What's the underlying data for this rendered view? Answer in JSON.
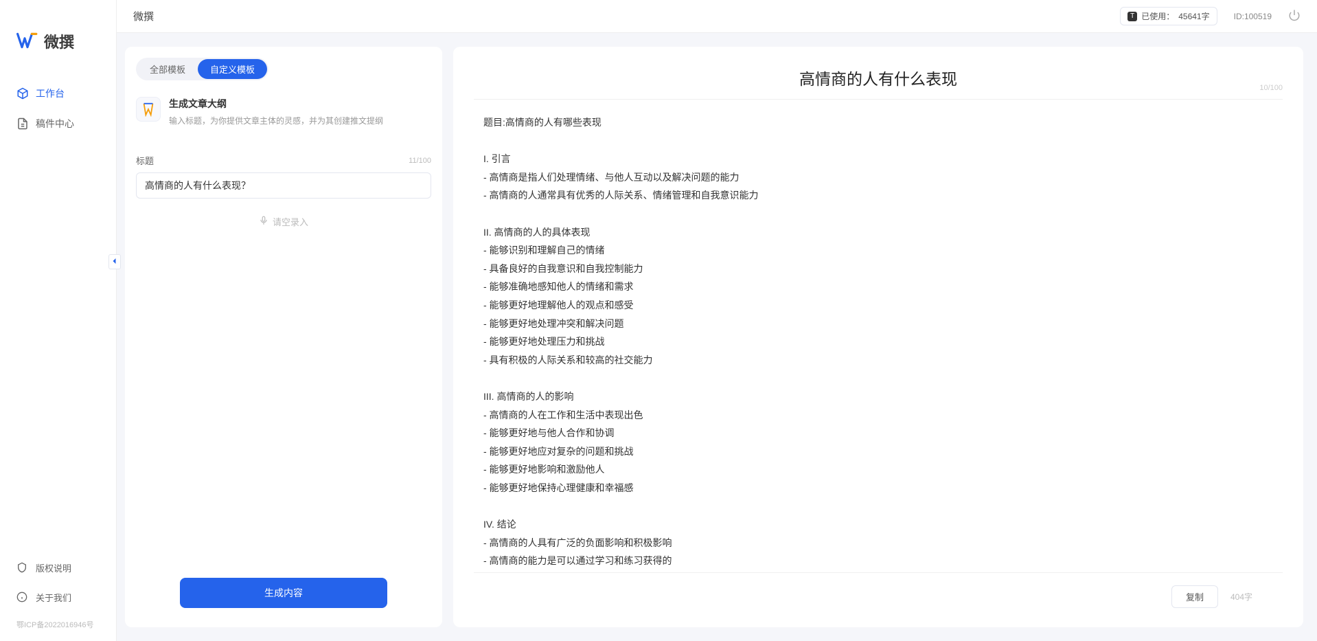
{
  "topbar": {
    "title": "微撰",
    "usage_prefix": "已使用：",
    "usage_value": "45641字",
    "user_id": "ID:100519"
  },
  "sidebar": {
    "logo_text": "微撰",
    "nav": [
      {
        "label": "工作台",
        "icon": "cube"
      },
      {
        "label": "稿件中心",
        "icon": "doc"
      }
    ],
    "footer": [
      {
        "label": "版权说明",
        "icon": "shield"
      },
      {
        "label": "关于我们",
        "icon": "info"
      }
    ],
    "icp": "鄂ICP备2022016946号"
  },
  "left_panel": {
    "tabs": [
      "全部模板",
      "自定义模板"
    ],
    "template": {
      "title": "生成文章大纲",
      "desc": "输入标题，为你提供文章主体的灵感，并为其创建推文提纲"
    },
    "title_label": "标题",
    "title_count": "11/100",
    "title_value": "高情商的人有什么表现？",
    "voice_hint": "请空录入",
    "generate_btn": "生成内容"
  },
  "right_panel": {
    "heading": "高情商的人有什么表现",
    "heading_count": "10/100",
    "body": "题目:高情商的人有哪些表现\n\nI. 引言\n- 高情商是指人们处理情绪、与他人互动以及解决问题的能力\n- 高情商的人通常具有优秀的人际关系、情绪管理和自我意识能力\n\nII. 高情商的人的具体表现\n- 能够识别和理解自己的情绪\n- 具备良好的自我意识和自我控制能力\n- 能够准确地感知他人的情绪和需求\n- 能够更好地理解他人的观点和感受\n- 能够更好地处理冲突和解决问题\n- 能够更好地处理压力和挑战\n- 具有积极的人际关系和较高的社交能力\n\nIII. 高情商的人的影响\n- 高情商的人在工作和生活中表现出色\n- 能够更好地与他人合作和协调\n- 能够更好地应对复杂的问题和挑战\n- 能够更好地影响和激励他人\n- 能够更好地保持心理健康和幸福感\n\nIV. 结论\n- 高情商的人具有广泛的负面影响和积极影响\n- 高情商的能力是可以通过学习和练习获得的\n- 培养和提高高情商的能力对于个人的职业发展和生活质量至关重要。",
    "copy_btn": "复制",
    "word_count": "404字"
  }
}
